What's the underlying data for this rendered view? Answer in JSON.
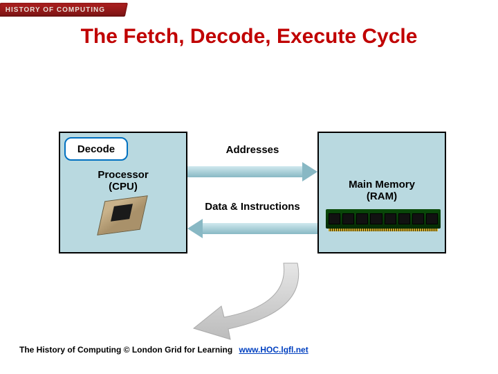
{
  "banner": "HISTORY OF COMPUTING",
  "title": "The Fetch, Decode, Execute Cycle",
  "cpu": {
    "bubble": "Decode",
    "label_line1": "Processor",
    "label_line2": "(CPU)"
  },
  "ram": {
    "label_line1": "Main Memory",
    "label_line2": "(RAM)"
  },
  "arrow_top": "Addresses",
  "arrow_bot": "Data & Instructions",
  "footer": {
    "text": "The History of Computing © London Grid for Learning",
    "link_text": "www.HOC.lgfl.net"
  }
}
